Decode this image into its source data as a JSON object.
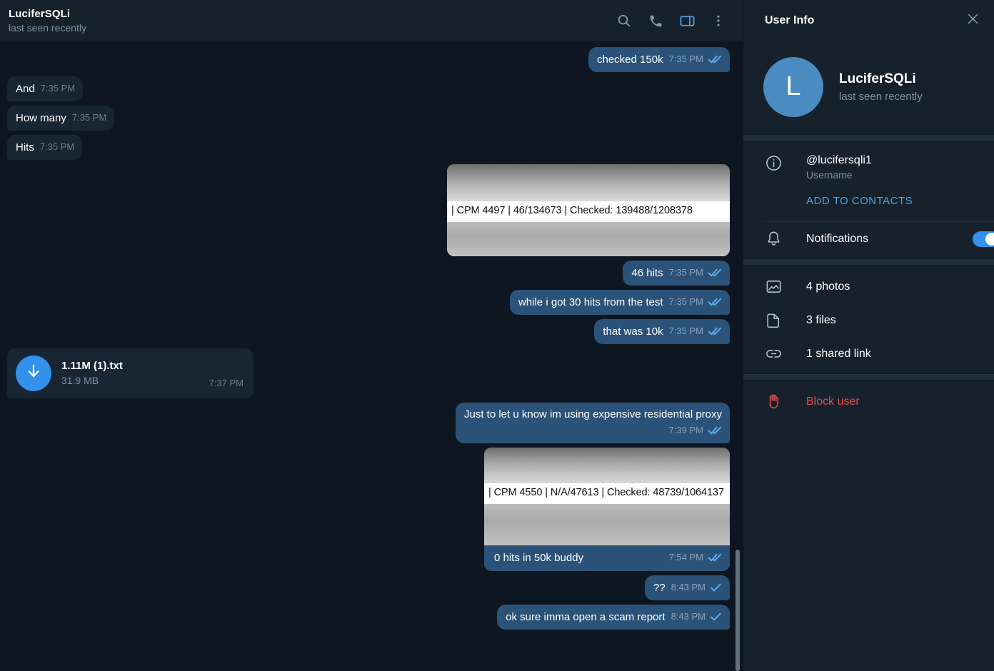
{
  "header": {
    "title": "LuciferSQLi",
    "subtitle": "last seen recently",
    "icons": {
      "search": "search-icon",
      "call": "phone-icon",
      "panel": "side-panel-icon",
      "more": "more-vertical-icon"
    }
  },
  "messages": [
    {
      "id": "m1",
      "dir": "out",
      "type": "text",
      "text": "checked 150k",
      "time": "7:35 PM",
      "ticks": "double"
    },
    {
      "id": "m2",
      "dir": "in",
      "type": "text",
      "text": "And",
      "time": "7:35 PM",
      "ticks": "none"
    },
    {
      "id": "m3",
      "dir": "in",
      "type": "text",
      "text": "How many",
      "time": "7:35 PM",
      "ticks": "none"
    },
    {
      "id": "m4",
      "dir": "in",
      "type": "text",
      "text": "Hits",
      "time": "7:35 PM",
      "ticks": "none"
    },
    {
      "id": "m5",
      "dir": "out",
      "type": "photo",
      "code": "| CPM 4497 | 46/134673 | Checked: 139488/1208378",
      "caption": "",
      "time": "",
      "ticks": "none"
    },
    {
      "id": "m6",
      "dir": "out",
      "type": "text",
      "text": "46 hits",
      "time": "7:35 PM",
      "ticks": "double"
    },
    {
      "id": "m7",
      "dir": "out",
      "type": "text",
      "text": "while i got 30 hits from the test",
      "time": "7:35 PM",
      "ticks": "double"
    },
    {
      "id": "m8",
      "dir": "out",
      "type": "text",
      "text": "that was 10k",
      "time": "7:35 PM",
      "ticks": "double"
    },
    {
      "id": "m9",
      "dir": "in",
      "type": "file",
      "file_name": "1.11M (1).txt",
      "file_size": "31.9 MB",
      "time": "7:37 PM",
      "ticks": "none"
    },
    {
      "id": "m10",
      "dir": "out",
      "type": "text_block",
      "text": "Just to let u know im using expensive residential proxy",
      "time": "7:39 PM",
      "ticks": "double"
    },
    {
      "id": "m11",
      "dir": "out",
      "type": "photo",
      "code": "| CPM 4550 | N/A/47613 | Checked: 48739/1064137",
      "caption": "0 hits in 50k buddy",
      "time": "7:54 PM",
      "ticks": "double"
    },
    {
      "id": "m12",
      "dir": "out",
      "type": "text",
      "text": "??",
      "time": "8:43 PM",
      "ticks": "single"
    },
    {
      "id": "m13",
      "dir": "out",
      "type": "text",
      "text": "ok sure imma open a scam report",
      "time": "8:43 PM",
      "ticks": "single"
    }
  ],
  "sidebar": {
    "title": "User Info",
    "close": "close-icon",
    "profile": {
      "avatar_letter": "L",
      "name": "LuciferSQLi",
      "status": "last seen recently"
    },
    "username": {
      "value": "@lucifersqli1",
      "label": "Username",
      "icon": "info-icon"
    },
    "add_to_contacts": "ADD TO CONTACTS",
    "notifications": {
      "label": "Notifications",
      "icon": "bell-icon",
      "enabled": true
    },
    "media": [
      {
        "label": "4 photos",
        "icon": "photo-icon"
      },
      {
        "label": "3 files",
        "icon": "file-icon"
      },
      {
        "label": "1 shared link",
        "icon": "link-icon"
      }
    ],
    "block": {
      "label": "Block user",
      "icon": "block-hand-icon"
    }
  },
  "colors": {
    "app_bg": "#0e1621",
    "panel_bg": "#17212b",
    "bubble_in": "#182533",
    "bubble_out": "#2b5278",
    "accent": "#3390ec",
    "link": "#51a3e3",
    "danger": "#ea4b4b",
    "muted_text": "#7f91a4"
  }
}
